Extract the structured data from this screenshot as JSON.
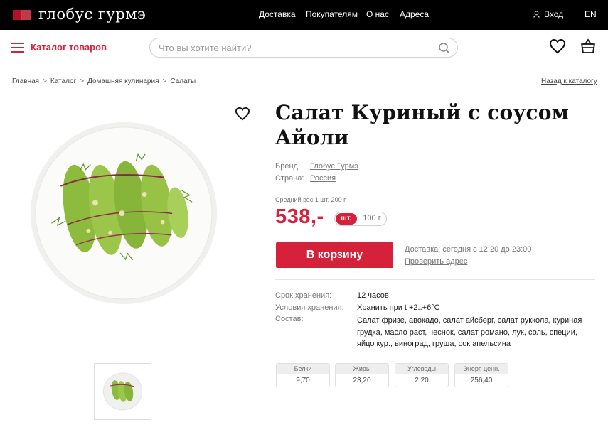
{
  "brand": {
    "logo_text": "глобус гурмэ",
    "accent_color": "#d6213a"
  },
  "topnav": {
    "items": [
      "Доставка",
      "Покупателям",
      "О нас",
      "Адреса"
    ],
    "login": "Вход",
    "lang": "EN"
  },
  "header": {
    "catalog": "Каталог товаров",
    "search_placeholder": "Что вы хотите найти?"
  },
  "breadcrumb": {
    "items": [
      "Главная",
      "Каталог",
      "Домашняя кулинария",
      "Салаты"
    ],
    "separator": ">",
    "back": "Назад к каталогу"
  },
  "product": {
    "title_line1": "Салат Куриный с соусом",
    "title_line2": "Айоли",
    "brand_label": "Бренд:",
    "brand_value": "Глобус Гурмэ",
    "country_label": "Страна:",
    "country_value": "Россия",
    "weight_note": "Средний вес 1 шт. 200 г",
    "price": "538,-",
    "unit_active": "шт.",
    "unit_inactive": "100 г",
    "cart_button": "В корзину",
    "delivery": "Доставка: сегодня с 12:20 до 23:00",
    "check_address": "Проверить адрес",
    "attributes": [
      {
        "label": "Срок хранения:",
        "value": "12 часов"
      },
      {
        "label": "Условия хранения:",
        "value": "Хранить при t +2..+6°C"
      },
      {
        "label": "Состав:",
        "value": "Салат фризе, авокадо, салат айсберг, салат руккола, куриная грудка, масло раст, чеснок, салат романо, лук, соль, специи, яйцо кур., виноград, груша, сок апельсина"
      }
    ],
    "nutrition": [
      {
        "label": "Белки",
        "value": "9,70"
      },
      {
        "label": "Жиры",
        "value": "23,20"
      },
      {
        "label": "Углеводы",
        "value": "2,20"
      },
      {
        "label": "Энерг. ценн.",
        "value": "256,40"
      }
    ]
  }
}
